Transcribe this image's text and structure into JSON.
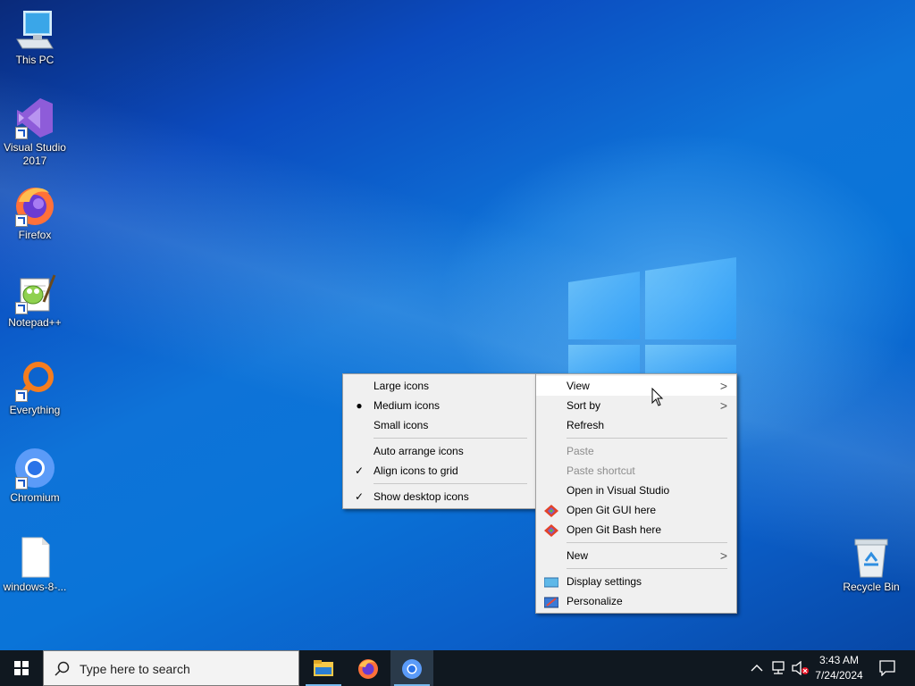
{
  "desktop": {
    "icons": [
      {
        "label": "This PC"
      },
      {
        "label": "Visual Studio 2017"
      },
      {
        "label": "Firefox"
      },
      {
        "label": "Notepad++"
      },
      {
        "label": "Everything"
      },
      {
        "label": "Chromium"
      },
      {
        "label": "windows-8-..."
      },
      {
        "label": "Recycle Bin"
      }
    ]
  },
  "context_menu": {
    "items": [
      {
        "label": "View",
        "submenu": true,
        "highlighted": true
      },
      {
        "label": "Sort by",
        "submenu": true
      },
      {
        "label": "Refresh"
      },
      {
        "label": "Paste",
        "disabled": true
      },
      {
        "label": "Paste shortcut",
        "disabled": true
      },
      {
        "label": "Open in Visual Studio"
      },
      {
        "label": "Open Git GUI here",
        "icon": "git-gui-icon"
      },
      {
        "label": "Open Git Bash here",
        "icon": "git-bash-icon"
      },
      {
        "label": "New",
        "submenu": true
      },
      {
        "label": "Display settings",
        "icon": "display-settings-icon"
      },
      {
        "label": "Personalize",
        "icon": "personalize-icon"
      }
    ]
  },
  "view_submenu": {
    "items": [
      {
        "label": "Large icons",
        "mark": ""
      },
      {
        "label": "Medium icons",
        "mark": "●"
      },
      {
        "label": "Small icons",
        "mark": ""
      },
      {
        "label": "Auto arrange icons",
        "mark": ""
      },
      {
        "label": "Align icons to grid",
        "mark": "✓"
      },
      {
        "label": "Show desktop icons",
        "mark": "✓"
      }
    ]
  },
  "taskbar": {
    "search_placeholder": "Type here to search",
    "apps": [
      "file-explorer-icon",
      "firefox-icon",
      "chromium-icon"
    ],
    "active_app": "chromium-icon",
    "clock": {
      "time": "3:43 AM",
      "date": "7/24/2024"
    }
  },
  "colors": {
    "desktop_accent": "#0a74d8",
    "taskbar": "#101820",
    "active_underline": "#76b9ed"
  }
}
